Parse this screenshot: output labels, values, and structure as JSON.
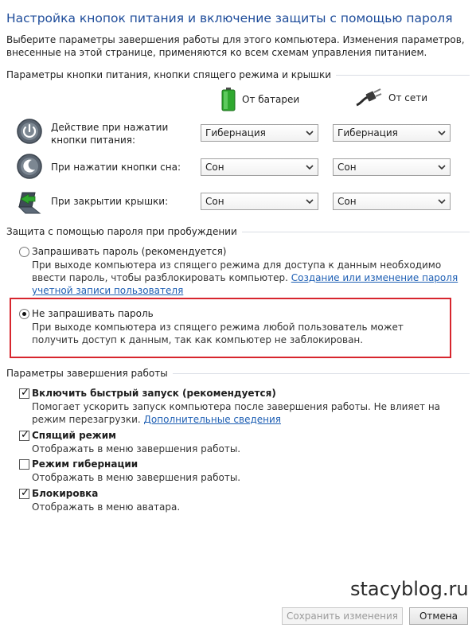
{
  "page_title": "Настройка кнопок питания и включение защиты с помощью пароля",
  "intro_text": "Выберите параметры завершения работы для этого компьютера. Изменения параметров, внесенные на этой странице, применяются ко всем схемам управления питанием.",
  "buttons_section": {
    "heading": "Параметры кнопки питания, кнопки спящего режима и крышки",
    "col_battery": "От батареи",
    "col_plugged": "От сети",
    "rows": [
      {
        "label": "Действие при нажатии кнопки питания:",
        "icon": "power-icon",
        "battery": "Гибернация",
        "plugged": "Гибернация"
      },
      {
        "label": "При нажатии кнопки сна:",
        "icon": "sleep-icon",
        "battery": "Сон",
        "plugged": "Сон"
      },
      {
        "label": "При закрытии крышки:",
        "icon": "laptop-lid-icon",
        "battery": "Сон",
        "plugged": "Сон"
      }
    ]
  },
  "password_section": {
    "heading": "Защита с помощью пароля при пробуждении",
    "require": {
      "title": "Запрашивать пароль (рекомендуется)",
      "desc": "При выходе компьютера из спящего режима для доступа к данным необходимо ввести пароль, чтобы разблокировать компьютер.",
      "link": "Создание или изменение пароля учетной записи пользователя",
      "checked": false
    },
    "no_require": {
      "title": "Не запрашивать пароль",
      "desc": "При выходе компьютера из спящего режима любой пользователь может получить доступ к данным, так как компьютер не заблокирован.",
      "checked": true
    }
  },
  "shutdown_section": {
    "heading": "Параметры завершения работы",
    "items": [
      {
        "title": "Включить быстрый запуск (рекомендуется)",
        "desc": "Помогает ускорить запуск компьютера после завершения работы. Не влияет на режим перезагрузки.",
        "link": "Дополнительные сведения",
        "checked": true
      },
      {
        "title": "Спящий режим",
        "desc": "Отображать в меню завершения работы.",
        "checked": true
      },
      {
        "title": "Режим гибернации",
        "desc": "Отображать в меню завершения работы.",
        "checked": false
      },
      {
        "title": "Блокировка",
        "desc": "Отображать в меню аватара.",
        "checked": true
      }
    ]
  },
  "watermark": "stacyblog.ru",
  "footer": {
    "save_label": "Сохранить изменения",
    "cancel_label": "Отмена"
  },
  "colors": {
    "title": "#1e4c9a",
    "link": "#1e5fb4",
    "highlight": "#d7262e"
  }
}
